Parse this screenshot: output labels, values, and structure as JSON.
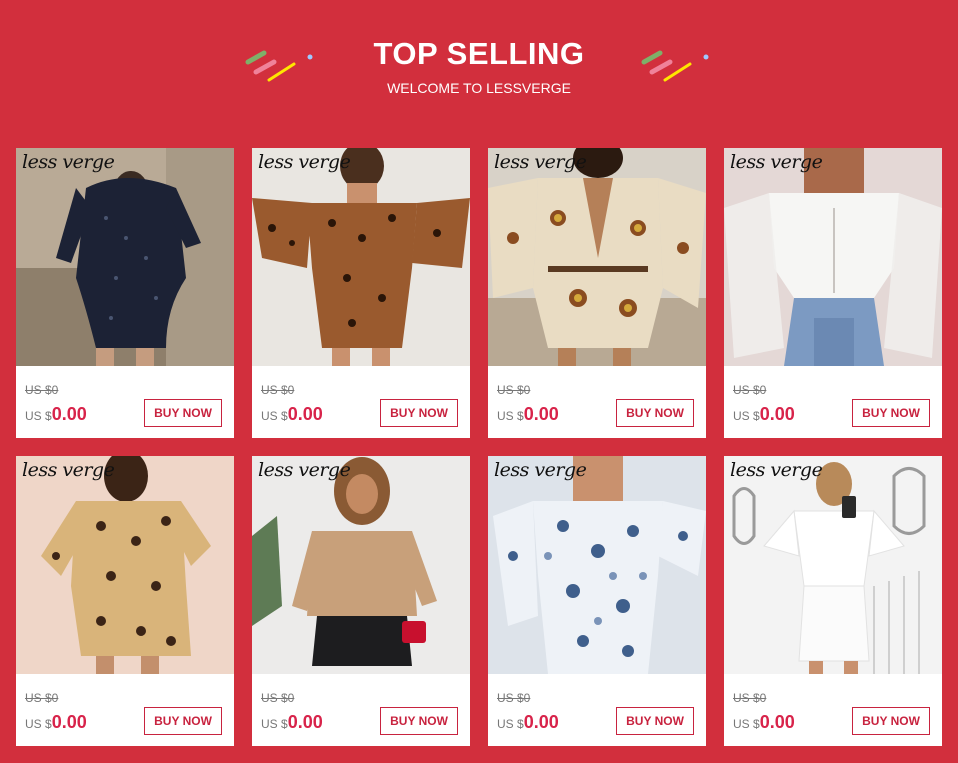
{
  "header": {
    "title": "TOP SELLING",
    "subtitle": "WELCOME TO LESSVERGE"
  },
  "colors": {
    "background": "#d22f3d",
    "accent": "#d8234a",
    "card": "#ffffff"
  },
  "products": [
    {
      "brand": "less verge",
      "image": "black-sequin-mini-dress",
      "old_price": "US $0",
      "currency": "US $",
      "price": "0.00",
      "button": "BUY NOW"
    },
    {
      "brand": "less verge",
      "image": "leopard-off-shoulder-mini-dress",
      "old_price": "US $0",
      "currency": "US $",
      "price": "0.00",
      "button": "BUY NOW"
    },
    {
      "brand": "less verge",
      "image": "paisley-print-romper",
      "old_price": "US $0",
      "currency": "US $",
      "price": "0.00",
      "button": "BUY NOW"
    },
    {
      "brand": "less verge",
      "image": "white-corset-top-mesh-sleeves",
      "old_price": "US $0",
      "currency": "US $",
      "price": "0.00",
      "button": "BUY NOW"
    },
    {
      "brand": "less verge",
      "image": "leopard-puff-sleeve-dress",
      "old_price": "US $0",
      "currency": "US $",
      "price": "0.00",
      "button": "BUY NOW"
    },
    {
      "brand": "less verge",
      "image": "beige-knit-sweater-leather-shorts",
      "old_price": "US $0",
      "currency": "US $",
      "price": "0.00",
      "button": "BUY NOW"
    },
    {
      "brand": "less verge",
      "image": "blue-floral-bodycon-dress",
      "old_price": "US $0",
      "currency": "US $",
      "price": "0.00",
      "button": "BUY NOW"
    },
    {
      "brand": "less verge",
      "image": "white-bow-mini-dress",
      "old_price": "US $0",
      "currency": "US $",
      "price": "0.00",
      "button": "BUY NOW"
    }
  ]
}
